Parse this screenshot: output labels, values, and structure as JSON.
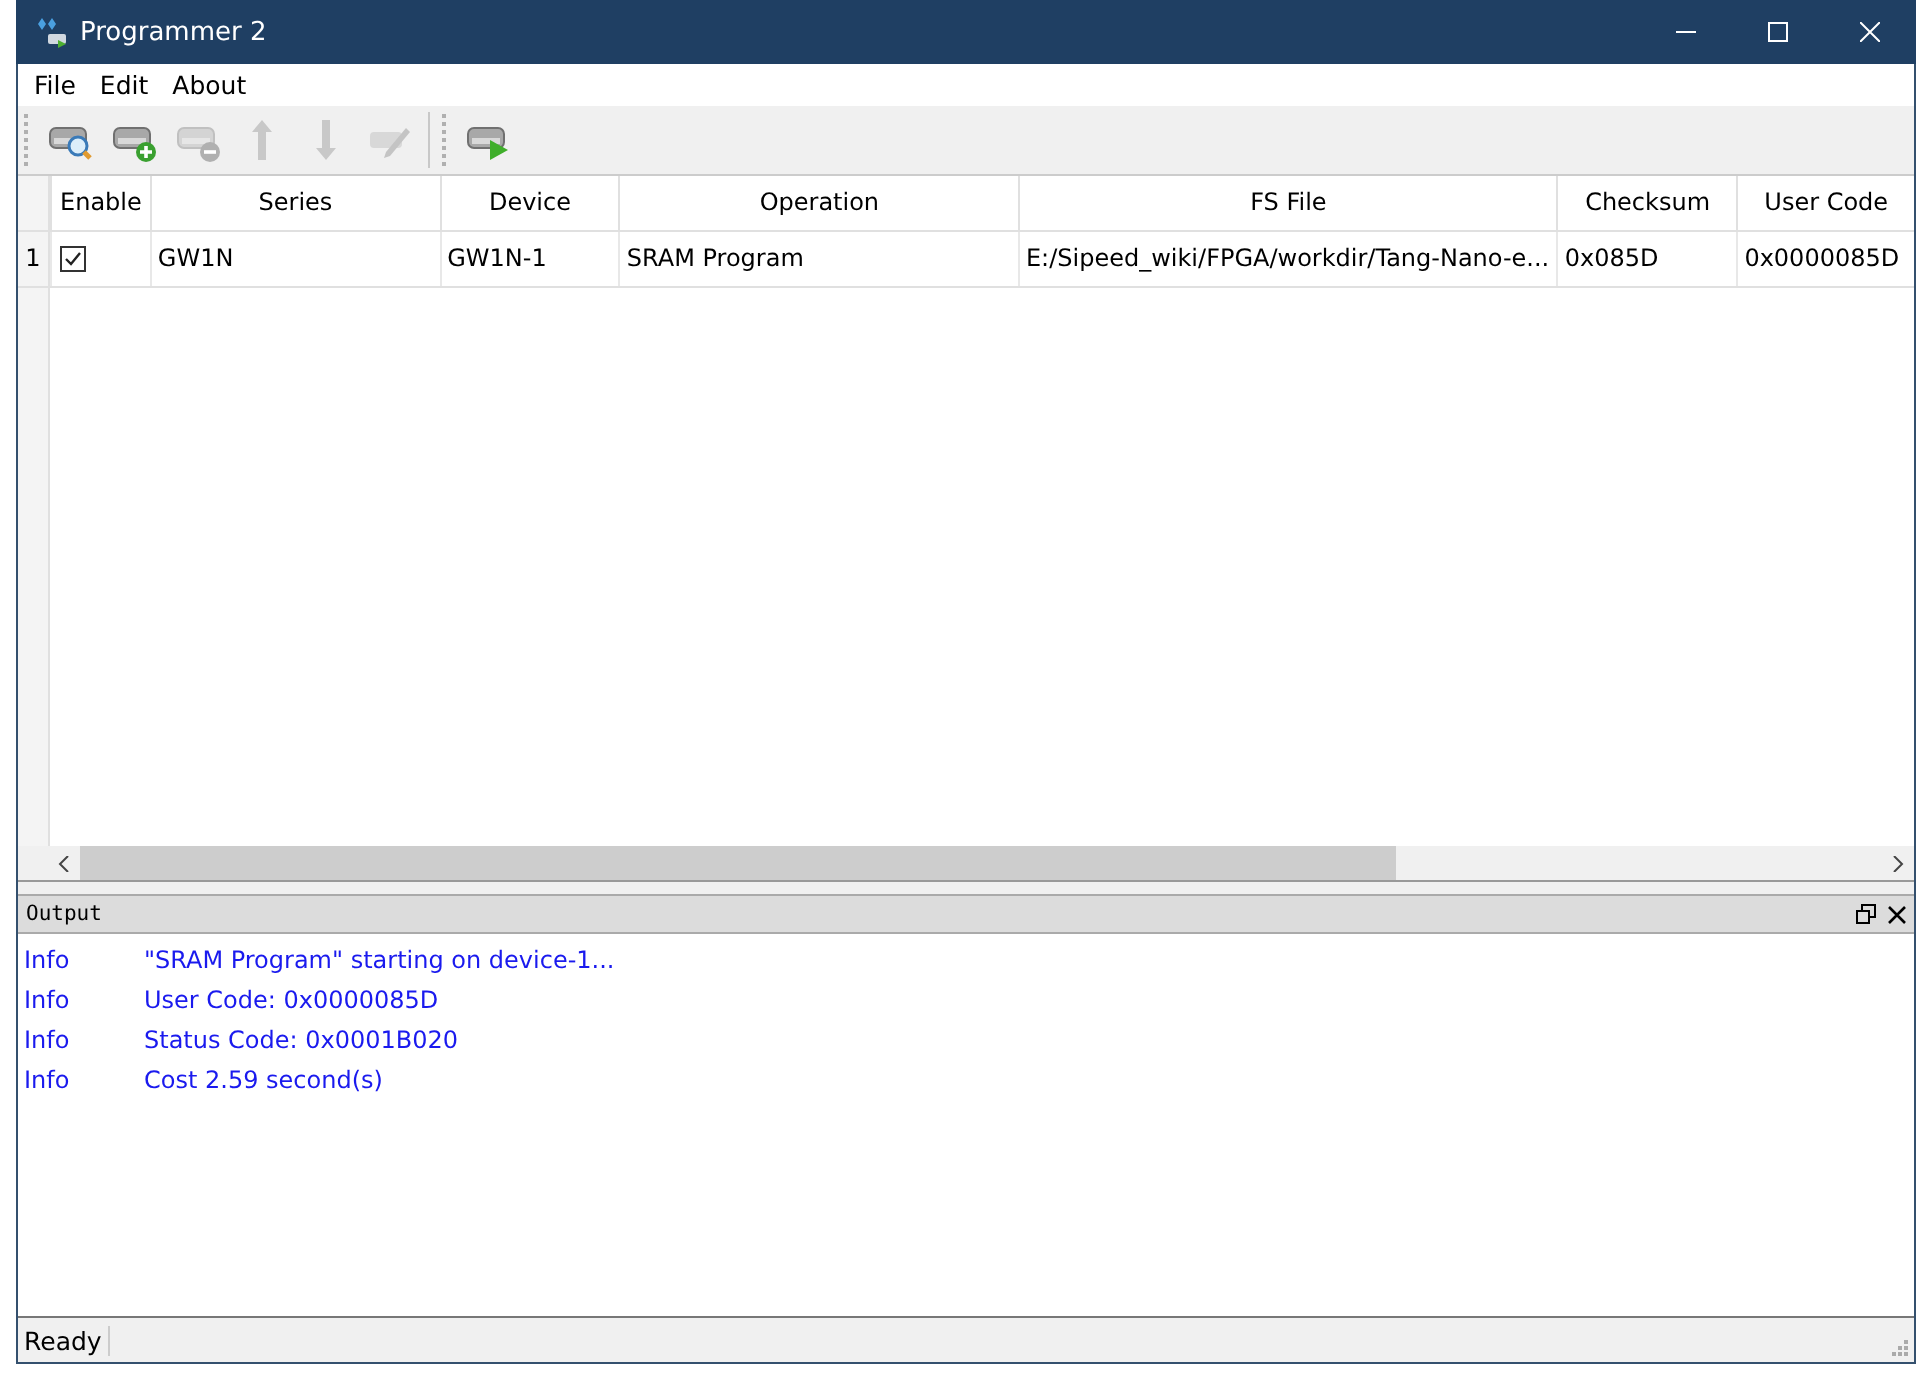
{
  "window": {
    "title": "Programmer 2"
  },
  "menu": [
    "File",
    "Edit",
    "About"
  ],
  "toolbar": [
    {
      "kind": "scan",
      "disabled": false
    },
    {
      "kind": "add",
      "disabled": false
    },
    {
      "kind": "remove",
      "disabled": true
    },
    {
      "kind": "up",
      "disabled": true
    },
    {
      "kind": "down",
      "disabled": true
    },
    {
      "kind": "edit",
      "disabled": true
    },
    {
      "kind": "run",
      "disabled": false
    }
  ],
  "table": {
    "columns": [
      "Enable",
      "Series",
      "Device",
      "Operation",
      "FS File",
      "Checksum",
      "User Code"
    ],
    "rows": [
      {
        "number": "1",
        "cells": [
          {
            "kind": "checkbox",
            "checked": true
          },
          {
            "kind": "text",
            "text": "GW1N"
          },
          {
            "kind": "text",
            "text": "GW1N-1"
          },
          {
            "kind": "text",
            "text": "SRAM Program"
          },
          {
            "kind": "text",
            "text": "E:/Sipeed_wiki/FPGA/workdir/Tang-Nano-e..."
          },
          {
            "kind": "text",
            "text": "0x085D"
          },
          {
            "kind": "text",
            "text": "0x0000085D"
          }
        ]
      }
    ]
  },
  "output": {
    "title": "Output",
    "lines": [
      {
        "level": "Info",
        "message": "\"SRAM Program\" starting on device-1..."
      },
      {
        "level": "Info",
        "message": "User Code: 0x0000085D"
      },
      {
        "level": "Info",
        "message": "Status Code: 0x0001B020"
      },
      {
        "level": "Info",
        "message": "Cost 2.59 second(s)"
      }
    ]
  },
  "status_bar": "Ready"
}
